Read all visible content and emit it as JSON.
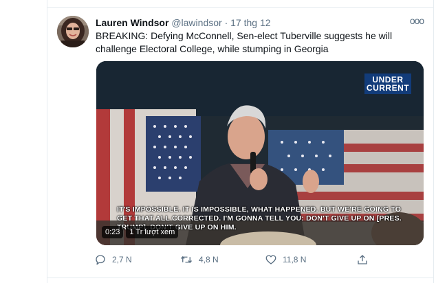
{
  "tweet": {
    "author_name": "Lauren Windsor",
    "author_handle": "@lawindsor",
    "separator": "·",
    "timestamp": "17 thg 12",
    "more_label": "ooo",
    "text": "BREAKING: Defying McConnell, Sen-elect Tuberville suggests he will challenge Electoral College, while stumping in Georgia"
  },
  "media": {
    "logo_line1": "UNDER",
    "logo_line2": "CURRENT",
    "caption": "It's impossible. It is impossible, what happened. But we're going to get that all corrected. I'm gonna tell you: don't give up on [Pres. Trump]. Don't give up on him.",
    "duration": "0:23",
    "views": "1 Tr lượt xem"
  },
  "actions": {
    "reply_count": "2,7 N",
    "retweet_count": "4,8 N",
    "like_count": "11,8 N",
    "reply_icon": "comment-icon",
    "retweet_icon": "retweet-icon",
    "like_icon": "heart-icon",
    "share_icon": "share-icon"
  },
  "colors": {
    "text_primary": "#0f1419",
    "text_secondary": "#5b7083",
    "divider": "#e6ecf0"
  }
}
